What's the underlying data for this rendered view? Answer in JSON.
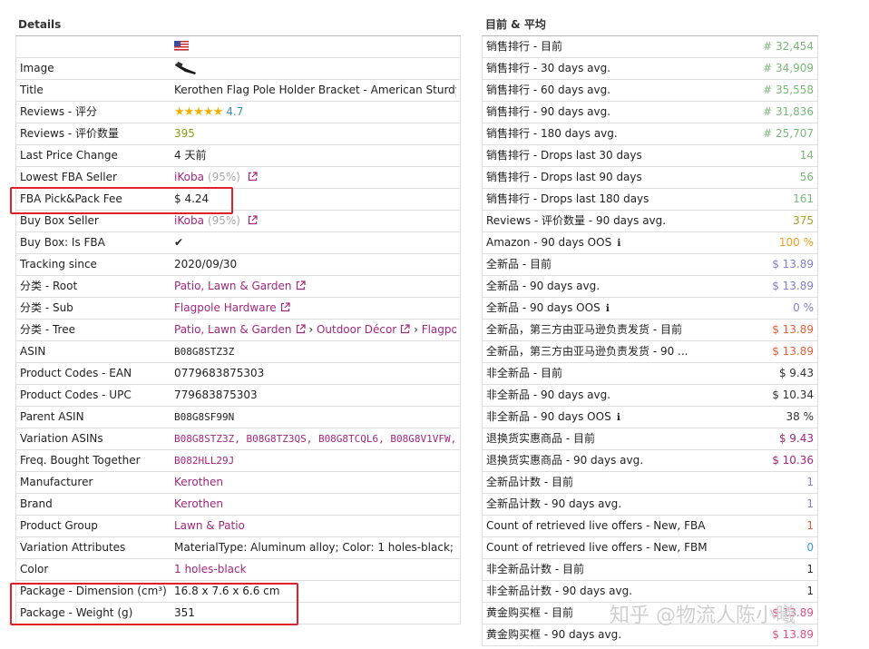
{
  "left": {
    "title": "Details",
    "rows": [
      {
        "label": "",
        "value": "",
        "type": "flag"
      },
      {
        "label": "Image",
        "value": "",
        "type": "image"
      },
      {
        "label": "Title",
        "value": "Kerothen Flag Pole Holder Bracket - American Sturdy Multi",
        "type": "text"
      },
      {
        "label": "Reviews - 评分",
        "value": "4.7",
        "type": "stars",
        "rating": 4.7
      },
      {
        "label": "Reviews - 评价数量",
        "value": "395",
        "type": "colored",
        "color": "#8aa015"
      },
      {
        "label": "Last Price Change",
        "value": "4 天前",
        "type": "text"
      },
      {
        "label": "Lowest FBA Seller",
        "value": "iKoba",
        "sub": "(95%)",
        "type": "seller"
      },
      {
        "label": "FBA Pick&Pack Fee",
        "value": "$ 4.24",
        "type": "text"
      },
      {
        "label": "Buy Box Seller",
        "value": "iKoba",
        "sub": "(95%)",
        "type": "seller"
      },
      {
        "label": "Buy Box: Is FBA",
        "value": "✔",
        "type": "text"
      },
      {
        "label": "Tracking since",
        "value": "2020/09/30",
        "type": "text"
      },
      {
        "label": "分类 - Root",
        "value": "Patio, Lawn & Garden",
        "type": "linkext"
      },
      {
        "label": "分类 - Sub",
        "value": "Flagpole Hardware",
        "type": "linkext"
      },
      {
        "label": "分类 - Tree",
        "value": "",
        "type": "tree",
        "tree": [
          "Patio, Lawn & Garden",
          "Outdoor Décor",
          "Flagpole"
        ]
      },
      {
        "label": "ASIN",
        "value": "B08G8STZ3Z",
        "type": "mono"
      },
      {
        "label": "Product Codes - EAN",
        "value": "0779683875303",
        "type": "text"
      },
      {
        "label": "Product Codes - UPC",
        "value": "779683875303",
        "type": "text"
      },
      {
        "label": "Parent ASIN",
        "value": "B08G8SF99N",
        "type": "mono"
      },
      {
        "label": "Variation ASINs",
        "value": "B08G8STZ3Z, B08G8TZ3QS, B08G8TCQL6, B08G8V1VFW,",
        "type": "monolink"
      },
      {
        "label": "Freq. Bought Together",
        "value": "B082HLL29J",
        "type": "monolink"
      },
      {
        "label": "Manufacturer",
        "value": "Kerothen",
        "type": "link"
      },
      {
        "label": "Brand",
        "value": "Kerothen",
        "type": "link"
      },
      {
        "label": "Product Group",
        "value": "Lawn & Patio",
        "type": "link"
      },
      {
        "label": "Variation Attributes",
        "value": "MaterialType: Aluminum alloy; Color: 1 holes-black;",
        "type": "text"
      },
      {
        "label": "Color",
        "value": "1 holes-black",
        "type": "link"
      },
      {
        "label": "Package - Dimension (cm³)",
        "value": "16.8 x 7.6 x 6.6 cm",
        "type": "text"
      },
      {
        "label": "Package - Weight (g)",
        "value": "351",
        "type": "text"
      }
    ]
  },
  "right": {
    "title": "目前 & 平均",
    "rows": [
      {
        "label": "销售排行 - 目前",
        "value": "# 32,454",
        "color": "#7cb87c"
      },
      {
        "label": "销售排行 - 30 days avg.",
        "value": "# 34,909",
        "color": "#7cb87c"
      },
      {
        "label": "销售排行 - 60 days avg.",
        "value": "# 35,558",
        "color": "#7cb87c"
      },
      {
        "label": "销售排行 - 90 days avg.",
        "value": "# 31,836",
        "color": "#7cb87c"
      },
      {
        "label": "销售排行 - 180 days avg.",
        "value": "# 25,707",
        "color": "#7cb87c"
      },
      {
        "label": "销售排行 - Drops last 30 days",
        "value": "14",
        "color": "#7cb87c"
      },
      {
        "label": "销售排行 - Drops last 90 days",
        "value": "56",
        "color": "#7cb87c"
      },
      {
        "label": "销售排行 - Drops last 180 days",
        "value": "161",
        "color": "#7cb87c"
      },
      {
        "label": "Reviews - 评价数量 - 90 days avg.",
        "value": "375",
        "color": "#a8a020"
      },
      {
        "label": "Amazon - 90 days OOS",
        "value": "100 %",
        "color": "#f0a020",
        "info": true
      },
      {
        "label": "全新品 - 目前",
        "value": "$ 13.89",
        "color": "#8080d0"
      },
      {
        "label": "全新品 - 90 days avg.",
        "value": "$ 13.89",
        "color": "#8080d0"
      },
      {
        "label": "全新品 - 90 days OOS",
        "value": "0 %",
        "color": "#8080d0",
        "info": true
      },
      {
        "label": "全新品，第三方由亚马逊负责发货 - 目前",
        "value": "$ 13.89",
        "color": "#e8603a"
      },
      {
        "label": "全新品，第三方由亚马逊负责发货 - 90 ...",
        "value": "$ 13.89",
        "color": "#e8603a"
      },
      {
        "label": "非全新品 - 目前",
        "value": "$ 9.43",
        "color": "#333333"
      },
      {
        "label": "非全新品 - 90 days avg.",
        "value": "$ 10.34",
        "color": "#333333"
      },
      {
        "label": "非全新品 - 90 days OOS",
        "value": "38 %",
        "color": "#333333",
        "info": true
      },
      {
        "label": "退换货实惠商品 - 目前",
        "value": "$ 9.43",
        "color": "#a0277c"
      },
      {
        "label": "退换货实惠商品 - 90 days avg.",
        "value": "$ 10.36",
        "color": "#a0277c"
      },
      {
        "label": "全新品计数 - 目前",
        "value": "1",
        "color": "#8080d0"
      },
      {
        "label": "全新品计数 - 90 days avg.",
        "value": "1",
        "color": "#8080d0"
      },
      {
        "label": "Count of retrieved live offers - New, FBA",
        "value": "1",
        "color": "#e8603a"
      },
      {
        "label": "Count of retrieved live offers - New, FBM",
        "value": "0",
        "color": "#3aa0d0"
      },
      {
        "label": "非全新品计数 - 目前",
        "value": "1",
        "color": "#333333"
      },
      {
        "label": "非全新品计数 - 90 days avg.",
        "value": "1",
        "color": "#333333"
      },
      {
        "label": "黄金购买框 - 目前",
        "value": "$ 13.89",
        "color": "#e0508a"
      },
      {
        "label": "黄金购买框 - 90 days avg.",
        "value": "$ 13.89",
        "color": "#e0508a"
      }
    ]
  },
  "watermark": "知乎 @物流人陈小曦"
}
